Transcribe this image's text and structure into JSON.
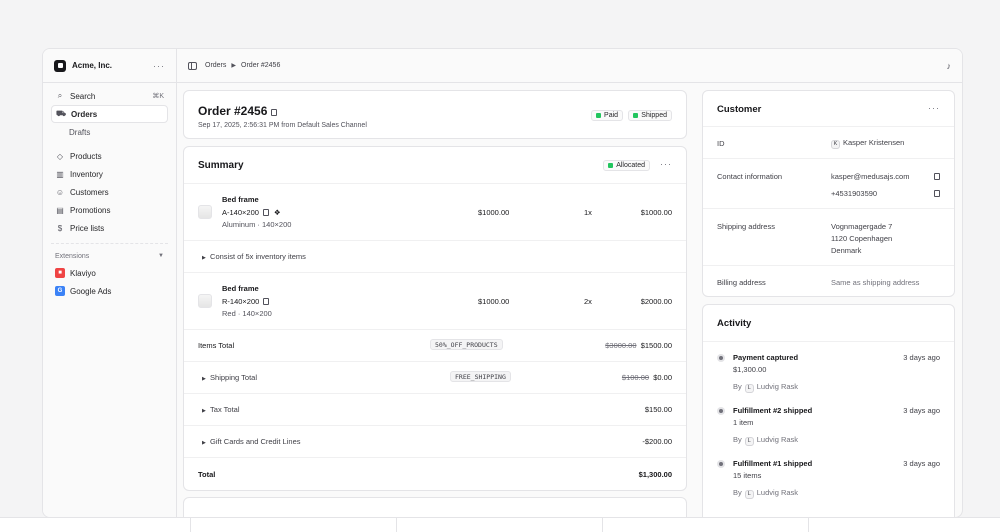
{
  "sidebar": {
    "org_name": "Acme, Inc.",
    "search": {
      "label": "Search",
      "shortcut": "⌘K"
    },
    "items": [
      {
        "label": "Orders",
        "icon": "cart-icon"
      },
      {
        "label": "Drafts"
      },
      {
        "label": "Products",
        "icon": "tag-icon"
      },
      {
        "label": "Inventory",
        "icon": "building-icon"
      },
      {
        "label": "Customers",
        "icon": "users-icon"
      },
      {
        "label": "Promotions",
        "icon": "receipt-icon"
      },
      {
        "label": "Price lists",
        "icon": "currency-icon"
      }
    ],
    "extensions_label": "Extensions",
    "extensions": [
      {
        "label": "Klaviyo",
        "color": "#ef4444"
      },
      {
        "label": "Google Ads",
        "color": "#3b82f6"
      }
    ]
  },
  "breadcrumb": {
    "root": "Orders",
    "current": "Order #2456"
  },
  "order": {
    "title": "Order #2456",
    "subtitle": "Sep 17, 2025, 2:56:31 PM from Default Sales Channel",
    "payment_status": "Paid",
    "fulfillment_status": "Shipped"
  },
  "summary": {
    "title": "Summary",
    "status": "Allocated",
    "items": [
      {
        "name": "Bed frame",
        "sku": "A-140×200",
        "variant": "Aluminum · 140×200",
        "price": "$1000.00",
        "qty": "1x",
        "total": "$1000.00"
      },
      {
        "name": "Bed frame",
        "sku": "R-140×200",
        "variant": "Red · 140×200",
        "price": "$1000.00",
        "qty": "2x",
        "total": "$2000.00"
      }
    ],
    "inventory_note": "Consist of 5x inventory items",
    "items_total": {
      "label": "Items Total",
      "code": "50%_OFF_PRODUCTS",
      "original": "$3000.00",
      "value": "$1500.00"
    },
    "shipping_total": {
      "label": "Shipping Total",
      "code": "FREE_SHIPPING",
      "original": "$100.00",
      "value": "$0.00"
    },
    "tax_total": {
      "label": "Tax Total",
      "value": "$150.00"
    },
    "gift_cards": {
      "label": "Gift Cards and Credit Lines",
      "value": "-$200.00"
    },
    "total": {
      "label": "Total",
      "value": "$1,300.00"
    }
  },
  "customer": {
    "title": "Customer",
    "id_label": "ID",
    "initial": "K",
    "name": "Kasper Kristensen",
    "contact_label": "Contact information",
    "email": "kasper@medusajs.com",
    "phone": "+4531903590",
    "shipping_label": "Shipping address",
    "shipping_lines": [
      "Vognmagergade 7",
      "1120 Copenhagen",
      "Denmark"
    ],
    "billing_label": "Billing address",
    "billing_value": "Same as shipping address"
  },
  "activity": {
    "title": "Activity",
    "by_label": "By",
    "events": [
      {
        "title": "Payment captured",
        "detail": "$1,300.00",
        "initial": "L",
        "user": "Ludvig Rask",
        "time": "3 days ago"
      },
      {
        "title": "Fulfillment #2 shipped",
        "detail": "1 item",
        "initial": "L",
        "user": "Ludvig Rask",
        "time": "3 days ago"
      },
      {
        "title": "Fulfillment #1 shipped",
        "detail": "15 items",
        "initial": "L",
        "user": "Ludvig Rask",
        "time": "3 days ago"
      }
    ]
  }
}
